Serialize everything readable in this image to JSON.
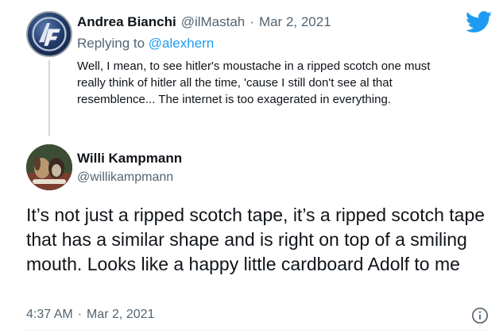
{
  "colors": {
    "accent": "#1d9bf0",
    "text_primary": "#0f1419",
    "text_secondary": "#536471",
    "thread_line": "#cfd9de"
  },
  "icons": {
    "brand": "twitter-bird-icon",
    "info": "info-circle-icon"
  },
  "parent_tweet": {
    "display_name": "Andrea Bianchi",
    "handle": "@ilMastah",
    "separator": "·",
    "date": "Mar 2, 2021",
    "replying_label": "Replying to",
    "replying_to": "@alexhern",
    "text": "Well, I mean, to see hitler's moustache in a ripped scotch one must really think of hitler all the time, 'cause I still don't see al that resemblence... The internet is too exagerated in everything."
  },
  "main_tweet": {
    "display_name": "Willi Kampmann",
    "handle": "@willikampmann",
    "text": "It’s not just a ripped scotch tape, it’s a ripped scotch tape that has a similar shape and is right on top of a smiling mouth. Looks like a happy little cardboard Adolf to me",
    "time": "4:37 AM",
    "separator": "·",
    "date": "Mar 2, 2021"
  }
}
